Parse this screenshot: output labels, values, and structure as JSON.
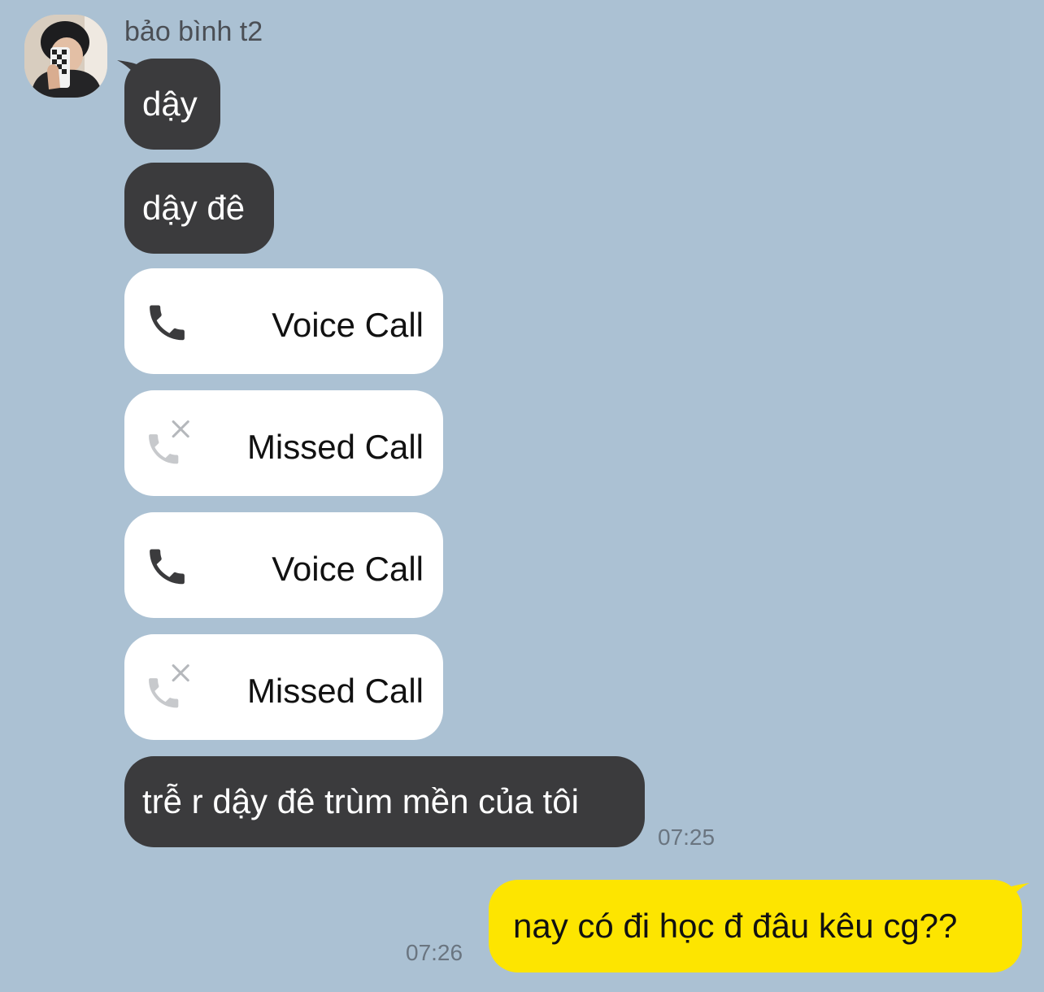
{
  "conversation": {
    "sender_name": "bảo bình t2",
    "messages": [
      {
        "text": "dậy"
      },
      {
        "text": "dậy đê"
      },
      {
        "call_label": "Voice Call",
        "icon": "phone-icon"
      },
      {
        "call_label": "Missed Call",
        "icon": "missed-call-icon"
      },
      {
        "call_label": "Voice Call",
        "icon": "phone-icon"
      },
      {
        "call_label": "Missed Call",
        "icon": "missed-call-icon"
      },
      {
        "text": "trễ r dậy đê trùm mền của tôi",
        "time": "07:25"
      }
    ],
    "my_messages": [
      {
        "text": "nay có đi học đ đâu kêu cg??",
        "time": "07:26"
      }
    ]
  },
  "colors": {
    "background": "#abc1d3",
    "incoming_bubble": "#3b3b3d",
    "call_bubble": "#ffffff",
    "outgoing_bubble": "#fde500"
  }
}
